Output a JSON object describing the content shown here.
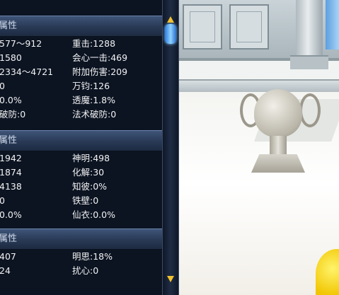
{
  "sections": [
    {
      "title": "属性",
      "rows": [
        [
          "577～912",
          "重击:1288"
        ],
        [
          "1580",
          "会心一击:469"
        ],
        [
          "2334～4721",
          "附加伤害:209"
        ],
        [
          "0",
          "万钧:126"
        ],
        [
          "0.0%",
          "透魔:1.8%"
        ],
        [
          "破防:0",
          "法术破防:0"
        ]
      ]
    },
    {
      "title": "属性",
      "rows": [
        [
          "1942",
          "神明:498"
        ],
        [
          "1874",
          "化解:30"
        ],
        [
          "4138",
          "知彼:0%"
        ],
        [
          "0",
          "铁壁:0"
        ],
        [
          "0.0%",
          "仙衣:0.0%"
        ]
      ]
    },
    {
      "title": "属性",
      "rows": [
        [
          "407",
          "明思:18%"
        ],
        [
          "24",
          "扰心:0"
        ]
      ]
    }
  ],
  "scrollbar": {
    "up_icon": "arrow-up-icon",
    "down_icon": "arrow-down-icon",
    "thumb_icon": "blue-gem-icon"
  },
  "colors": {
    "panel_bg": "#0c1422",
    "header_bg": "#2a3b58",
    "text": "#f2f2f2",
    "arrow": "#f2c12e",
    "thumb": "#5aaef5"
  }
}
